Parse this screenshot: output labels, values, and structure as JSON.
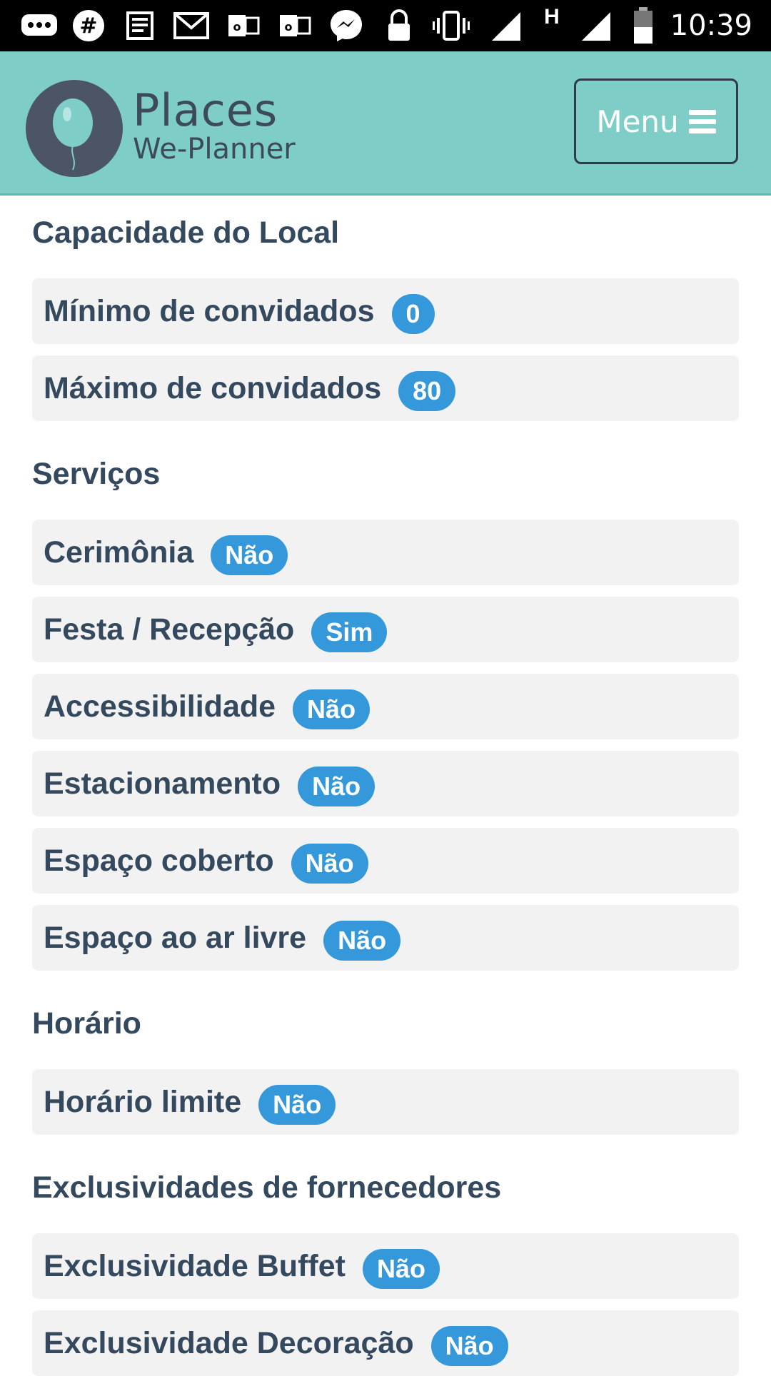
{
  "status_bar": {
    "time": "10:39",
    "icons": [
      "chat-bubble-icon",
      "slack-icon",
      "news-icon",
      "gmail-icon",
      "outlook-icon",
      "outlook-icon",
      "messenger-icon",
      "lock-icon",
      "vibrate-icon",
      "signal-icon",
      "h-network-icon",
      "signal-icon",
      "battery-icon"
    ],
    "network_label": "H"
  },
  "header": {
    "brand_title": "Places",
    "brand_subtitle": "We-Planner",
    "menu_label": "Menu",
    "bg_color": "#7ecdc7"
  },
  "sections": [
    {
      "title": "Capacidade do Local",
      "items": [
        {
          "label": "Mínimo de convidados",
          "value": "0"
        },
        {
          "label": "Máximo de convidados",
          "value": "80"
        }
      ]
    },
    {
      "title": "Serviços",
      "items": [
        {
          "label": "Cerimônia",
          "value": "Não"
        },
        {
          "label": "Festa / Recepção",
          "value": "Sim"
        },
        {
          "label": "Accessibilidade",
          "value": "Não"
        },
        {
          "label": "Estacionamento",
          "value": "Não"
        },
        {
          "label": "Espaço coberto",
          "value": "Não"
        },
        {
          "label": "Espaço ao ar livre",
          "value": "Não"
        }
      ]
    },
    {
      "title": "Horário",
      "items": [
        {
          "label": "Horário limite",
          "value": "Não"
        }
      ]
    },
    {
      "title": "Exclusividades de fornecedores",
      "items": [
        {
          "label": "Exclusividade Buffet",
          "value": "Não"
        },
        {
          "label": "Exclusividade Decoração",
          "value": "Não"
        }
      ]
    }
  ],
  "colors": {
    "badge": "#3498db",
    "item_bg": "#f2f2f2",
    "text": "#34495e"
  }
}
